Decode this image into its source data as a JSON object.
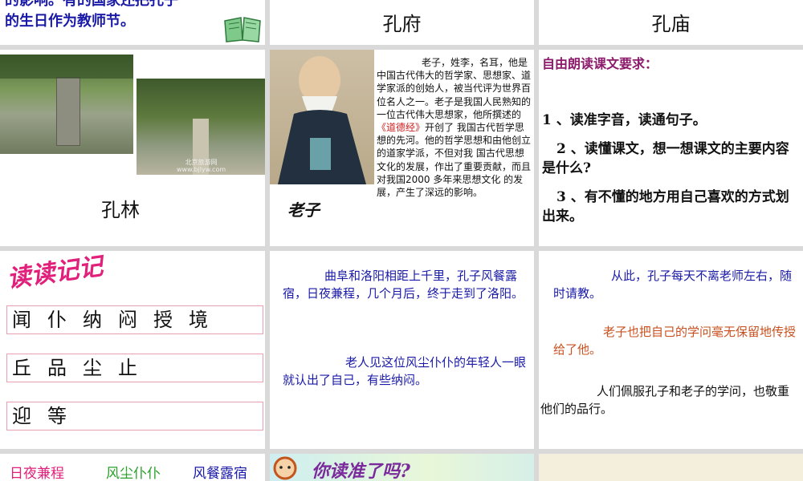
{
  "row1": {
    "intro_line1": "的影响。有的国家还把孔子",
    "intro_line2": "的生日作为教师节。",
    "title_mansion": "孔府",
    "title_temple": "孔庙"
  },
  "row2": {
    "forest_label": "孔林",
    "photo_watermark_line1": "北京旅游网",
    "photo_watermark_line2": "www.bjlyw.com",
    "laozi_label": "老子",
    "laozi_bio_1": "老子，姓李，名耳，他是中国古代伟大的哲学家、思想家、道学家派的创始人，被当代评为世界百位名人之一。老子是我国人民熟知的一位古代伟大思想家，他所撰述的",
    "laozi_book": "《道德经》",
    "laozi_bio_2": "开创了 我国古代哲学思想的先河。他的哲学思想和由他创立的道家学派，不但对我 国古代思想文化的发展，作出了重要贡献，而且对我国2000 多年来思想文化 的发展，产生了深远的影响。",
    "req_title": "自由朗读课文要求：",
    "req_1": "1 、读准字音，读通句子。",
    "req_2": "2 、读懂课文，想一想课文的主要内容是什么?",
    "req_3": "3 、有不懂的地方用自己喜欢的方式划出来。"
  },
  "row3": {
    "read_title": "读读记记",
    "chars_row1": [
      "闻",
      "仆",
      "纳",
      "闷",
      "授",
      "境"
    ],
    "chars_row2": [
      "丘",
      "品",
      "尘",
      "止"
    ],
    "chars_row3": [
      "迎",
      "等"
    ],
    "passage_1": "曲阜和洛阳相距上千里，孔子风餐露宿，日夜兼程，几个月后，终于走到了洛阳。",
    "passage_2": "老人见这位风尘仆仆的年轻人一眼就认出了自己，有些纳闷。",
    "passage_3": "从此，孔子每天不离老师左右，随时请教。",
    "passage_4": "老子也把自己的学问毫无保留地传授给了他。",
    "passage_5": "人们佩服孔子和老子的学问，也敬重他们的品行。"
  },
  "row4": {
    "word_1": "日夜兼程",
    "word_2": "风尘仆仆",
    "word_3": "风餐露宿",
    "quiz_title": "你读准了吗?"
  },
  "colors": {
    "blue_text": "#1a1aa8",
    "purple_heading": "#8b1a6b",
    "orange_text": "#c8501e",
    "word_red": "#e0207a",
    "word_green": "#2aa02a"
  }
}
